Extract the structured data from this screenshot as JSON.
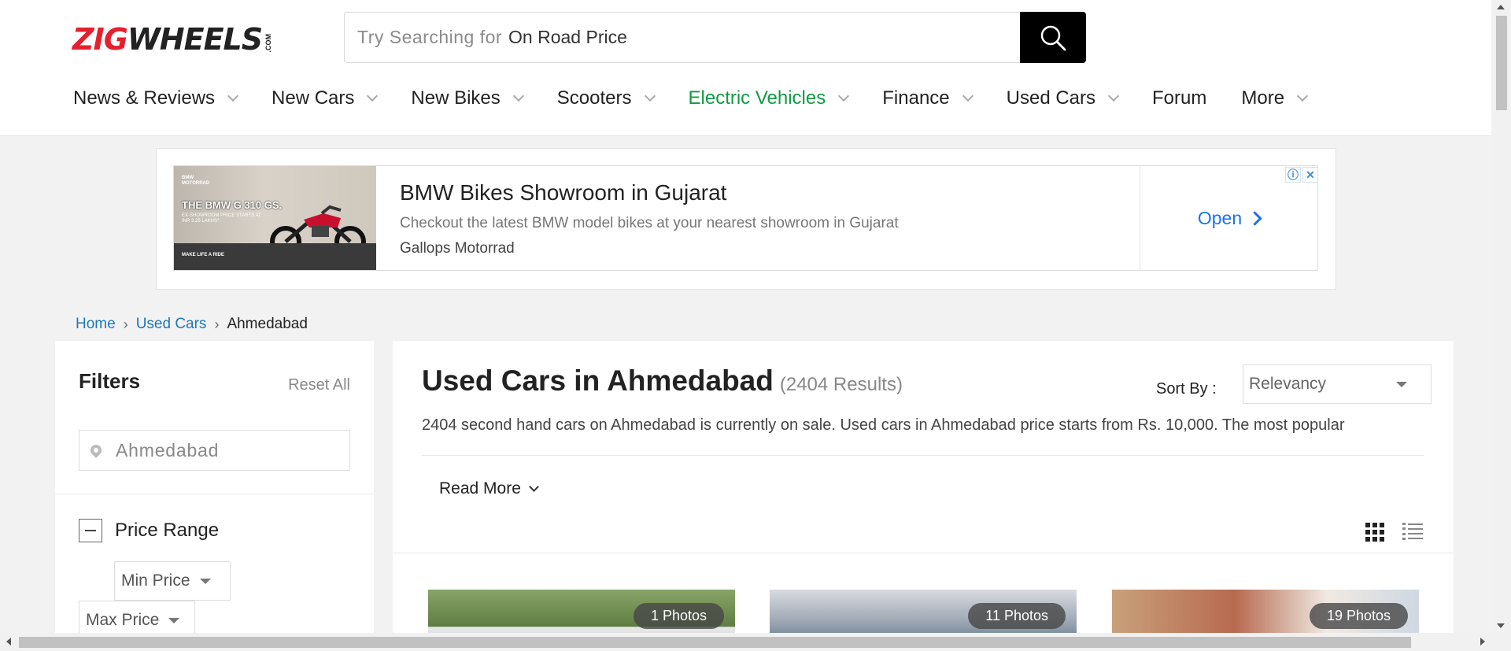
{
  "header": {
    "logo": {
      "part1": "ZIG",
      "part2": "WHEELS",
      "suffix": ".COM"
    },
    "search": {
      "prompt": "Try Searching for",
      "rotating_term": "On Road Price",
      "icon": "search-icon"
    },
    "nav": [
      {
        "label": "News & Reviews",
        "dropdown": true
      },
      {
        "label": "New Cars",
        "dropdown": true
      },
      {
        "label": "New Bikes",
        "dropdown": true
      },
      {
        "label": "Scooters",
        "dropdown": true
      },
      {
        "label": "Electric Vehicles",
        "dropdown": true,
        "color": "#139a43"
      },
      {
        "label": "Finance",
        "dropdown": true
      },
      {
        "label": "Used Cars",
        "dropdown": true
      },
      {
        "label": "Forum",
        "dropdown": false
      },
      {
        "label": "More",
        "dropdown": true
      }
    ]
  },
  "ad": {
    "image": {
      "brand_lines": [
        "BMW",
        "MOTORRAD"
      ],
      "headline": "THE BMW G 310 GS.",
      "subline": "EX-SHOWROOM PRICE STARTS AT INR 3.25 LAKHS*.",
      "tagline": "MAKE LIFE A RIDE"
    },
    "title": "BMW Bikes Showroom in Gujarat",
    "description": "Checkout the latest BMW model bikes at your nearest showroom in Gujarat",
    "advertiser": "Gallops Motorrad",
    "cta": "Open"
  },
  "breadcrumb": {
    "home": "Home",
    "used_cars": "Used Cars",
    "current": "Ahmedabad",
    "separator": "›"
  },
  "filters": {
    "title": "Filters",
    "reset": "Reset All",
    "location": "Ahmedabad",
    "price_range": {
      "label": "Price Range",
      "min": "Min Price",
      "max": "Max Price"
    }
  },
  "main": {
    "title": "Used Cars in Ahmedabad",
    "result_count": "(2404 Results)",
    "sort_label": "Sort By :",
    "sort_value": "Relevancy",
    "description": "2404 second hand cars on Ahmedabad is currently on sale. Used cars in Ahmedabad price starts from Rs. 10,000. The most popular",
    "read_more": "Read More",
    "cards": [
      {
        "photos": "1 Photos"
      },
      {
        "photos": "11 Photos"
      },
      {
        "photos": "19 Photos"
      }
    ]
  },
  "colors": {
    "brand_red": "#e5202e",
    "link_blue": "#1f78b8",
    "ev_green": "#139a43",
    "ad_blue": "#1a73e8"
  }
}
